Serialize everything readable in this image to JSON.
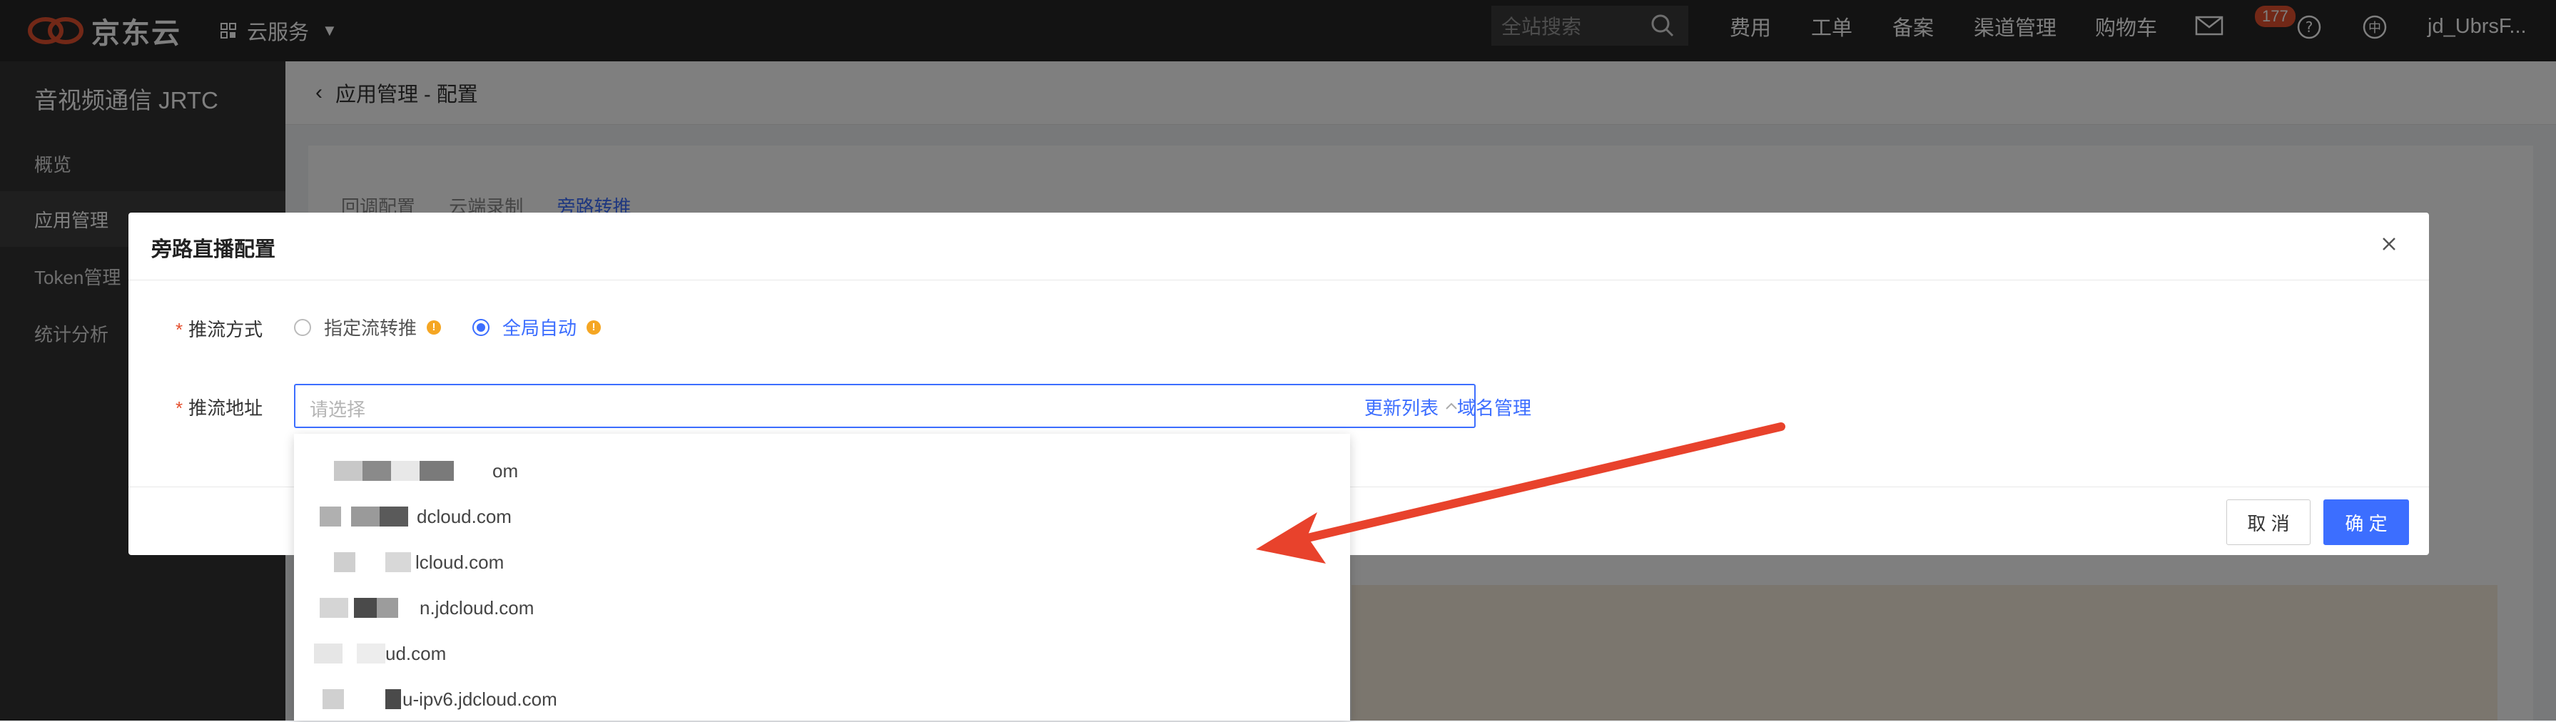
{
  "topbar": {
    "brand": "京东云",
    "service_menu": "云服务",
    "search_placeholder": "全站搜索",
    "nav": [
      "费用",
      "工单",
      "备案",
      "渠道管理",
      "购物车"
    ],
    "mail_badge": "177",
    "user": "jd_UbrsF...",
    "colors": {
      "brand": "#e4502f",
      "bg": "#262626"
    }
  },
  "sidebar": {
    "title": "音视频通信 JRTC",
    "items": [
      {
        "label": "概览",
        "active": false
      },
      {
        "label": "应用管理",
        "active": true
      },
      {
        "label": "Token管理",
        "active": false
      },
      {
        "label": "统计分析",
        "active": false
      }
    ]
  },
  "page": {
    "title": "应用管理 - 配置",
    "tabs": [
      "回调配置",
      "云端录制",
      "旁路转推"
    ],
    "active_tab": "旁路转推"
  },
  "modal": {
    "title": "旁路直播配置",
    "push_mode_label": "推流方式",
    "push_mode_options": [
      {
        "label": "指定流转推",
        "checked": false
      },
      {
        "label": "全局自动",
        "checked": true
      }
    ],
    "push_address_label": "推流地址",
    "push_address_placeholder": "请选择",
    "refresh_link": "更新列表",
    "domain_link": "域名管理",
    "cancel_label": "取 消",
    "ok_label": "确 定",
    "accent": "#3c6eff"
  },
  "dropdown": {
    "options": [
      "om",
      "dcloud.com",
      "lcloud.com",
      "n.jdcloud.com",
      "ud.com",
      "u-ipv6.jdcloud.com"
    ]
  }
}
